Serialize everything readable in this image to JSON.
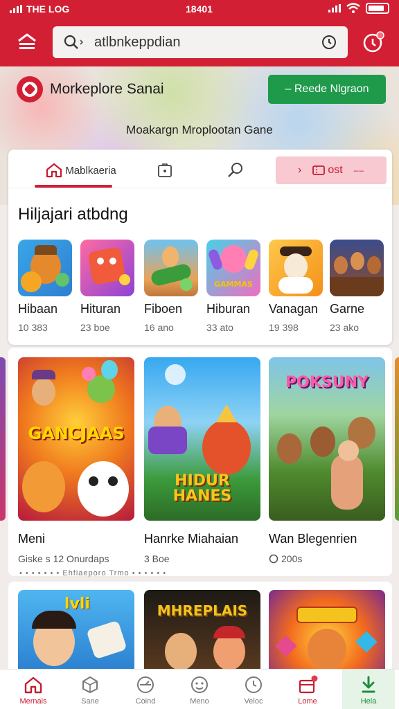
{
  "status_bar": {
    "carrier": "THE LOG",
    "time": "18401"
  },
  "search": {
    "value": "atlbnkeppdian"
  },
  "brand": {
    "name": "Morkeplore Sanai"
  },
  "promo_button": {
    "label": "– Reede Nlgraon"
  },
  "banner_subtitle": "Moakargn Mroplootan Gane",
  "tabs": {
    "home_label": "Mablkaeria",
    "promo_label": "ost"
  },
  "trending": {
    "title": "Hiljajari atbdng",
    "games": [
      {
        "name": "Hibaan",
        "meta": "10 383"
      },
      {
        "name": "Hituran",
        "meta": "23 boe"
      },
      {
        "name": "Fiboen",
        "meta": "16 ano"
      },
      {
        "name": "Hiburan",
        "meta": "33 ato"
      },
      {
        "name": "Vanagan",
        "meta": "19 398"
      },
      {
        "name": "Garne",
        "meta": "23 ako"
      }
    ]
  },
  "featured": [
    {
      "name": "Meni",
      "meta": "Giske s 12 Onurdaps",
      "poster_text": "GANCJAAS"
    },
    {
      "name": "Hanrke Miahaian",
      "meta": "3 Boe",
      "poster_text": "HIDUR HANES"
    },
    {
      "name": "Wan Blegenrien",
      "meta": "200s",
      "poster_text": "POKSUNY"
    }
  ],
  "more_strip": "• • • • • • • Ehfiaeporo Trmo • • • • • •",
  "second_row": [
    {
      "poster_text": "lvli"
    },
    {
      "poster_text": "MHREPLAIS"
    },
    {
      "poster_text": ""
    }
  ],
  "bottom_nav": [
    {
      "label": "Mernais",
      "icon": "home-icon"
    },
    {
      "label": "Sane",
      "icon": "cube-icon"
    },
    {
      "label": "Coind",
      "icon": "compass-icon"
    },
    {
      "label": "Meno",
      "icon": "face-icon"
    },
    {
      "label": "Veloc",
      "icon": "clock-icon"
    },
    {
      "label": "Lome",
      "icon": "gift-icon"
    },
    {
      "label": "Hela",
      "icon": "download-icon"
    }
  ],
  "colors": {
    "brand_red": "#d31f34",
    "promo_green": "#1e9a4a",
    "active_tab_bg": "#f8c9d0"
  }
}
